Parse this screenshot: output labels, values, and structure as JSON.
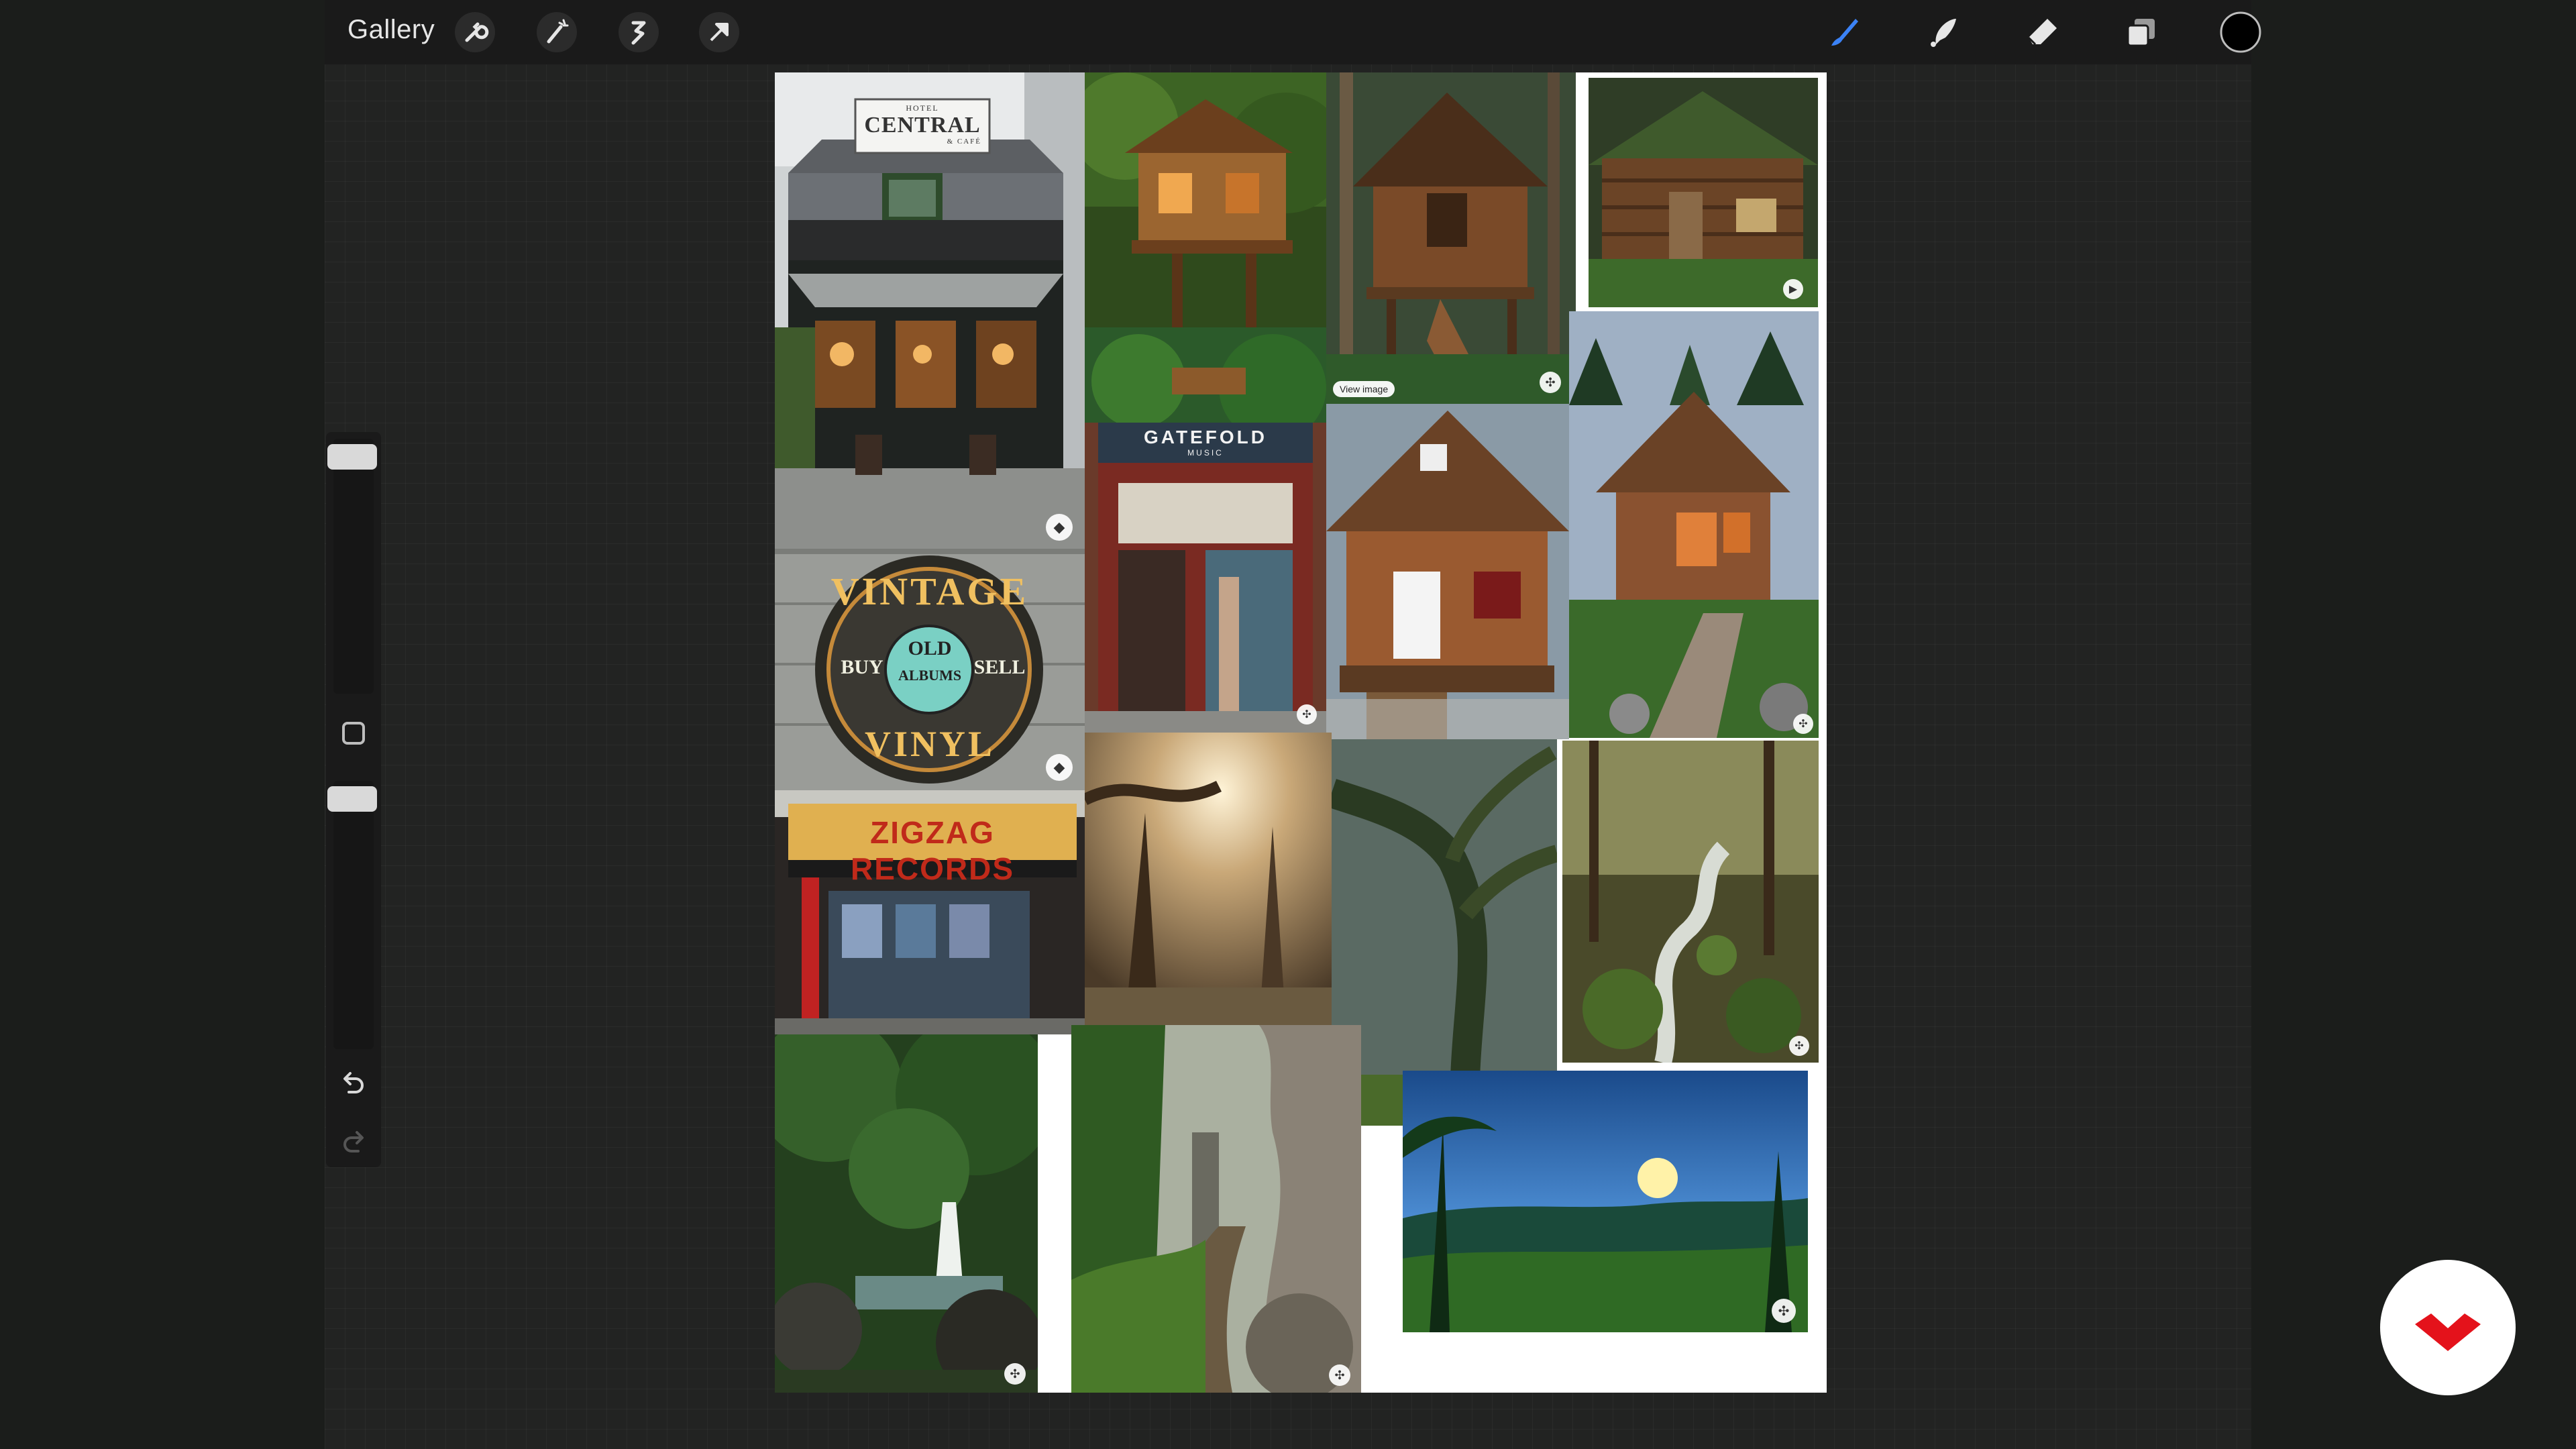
{
  "toolbar": {
    "gallery_label": "Gallery",
    "left_tools": [
      "wrench-icon",
      "magic-wand-icon",
      "selection-icon",
      "transform-arrow-icon"
    ],
    "right_tools": [
      "brush-icon",
      "smudge-icon",
      "eraser-icon",
      "layers-icon",
      "color-swatch-icon"
    ],
    "active_color": "#000000",
    "accent_color": "#3b82f6"
  },
  "sidebar": {
    "controls": [
      "brush-size-slider",
      "modify-button",
      "opacity-slider",
      "undo-icon",
      "redo-icon"
    ]
  },
  "canvas": {
    "background": "#ffffff",
    "hotel_sign": {
      "top": "HOTEL",
      "main": "CENTRAL",
      "sub": "& CAFÉ"
    },
    "vinyl_sign": {
      "vintage": "VINTAGE",
      "old": "OLD",
      "albums": "ALBUMS",
      "buy": "BUY",
      "sell": "SELL",
      "vinyl": "VINYL"
    },
    "gatefold_sign": {
      "name": "GATEFOLD",
      "sub": "MUSIC"
    },
    "zigzag_sign": {
      "name": "ZIGZAG RECORDS"
    },
    "pin_label": "View image"
  },
  "brand": {
    "name": "domestika-logo",
    "color": "#e4121b"
  }
}
